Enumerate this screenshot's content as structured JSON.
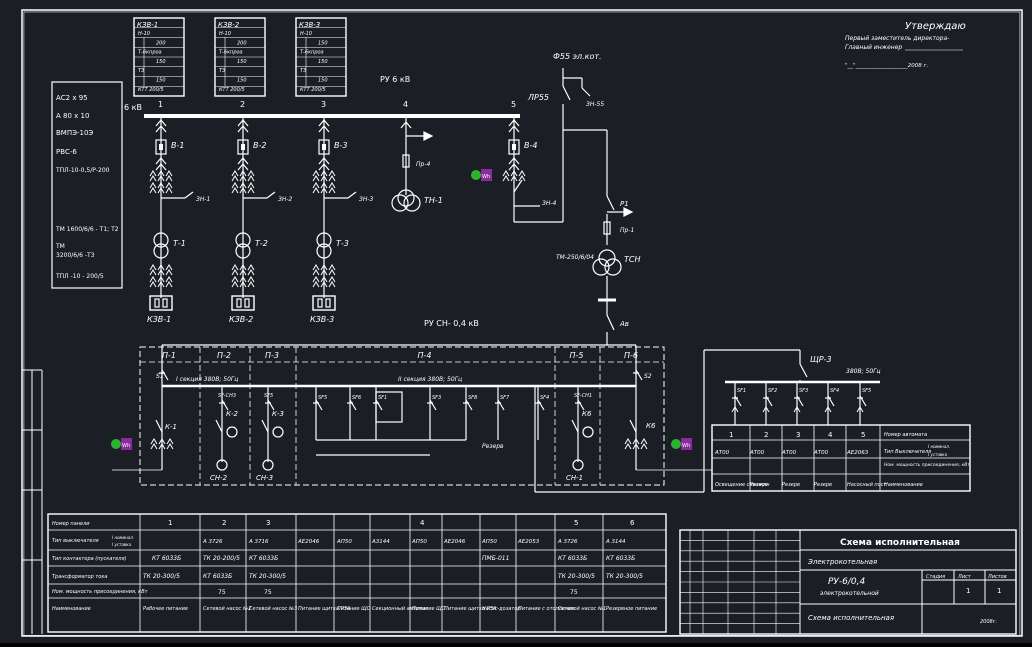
{
  "approval": {
    "title": "Утверждаю",
    "line1": "Первый заместитель директора-",
    "line2": "Главный инженер",
    "date_line": "\"__\"___________________2008 г."
  },
  "cells": [
    {
      "title": "КЗВ-1",
      "rows": [
        "Н-10",
        "200",
        "Т-6кпроа",
        "150",
        "ТЗ",
        "150",
        "КТТ 200/5"
      ]
    },
    {
      "title": "КЗВ-2",
      "rows": [
        "Н-10",
        "200",
        "Т-6кпроа",
        "150",
        "ТЗ",
        "150",
        "КТТ 200/5"
      ]
    },
    {
      "title": "КЗВ-3",
      "rows": [
        "Н-10",
        "150",
        "Т-6кпроа",
        "150",
        "ТЗ",
        "150",
        "КТТ 200/5"
      ]
    }
  ],
  "left_box": {
    "items": [
      "АС2 х 95",
      "А 80 х 10",
      "ВМПЭ-10Э",
      "РВС-6",
      "ТПЛ-10-0,5/Р-200",
      "ТМ 1600/6/6 - Т1; Т2",
      "ТМ",
      "3200/6/6 -Т3",
      "ТПЛ -10 - 200/5"
    ]
  },
  "hv": {
    "ru_label": "РУ 6 кВ",
    "bus_label": "6 кВ",
    "feeders": [
      "1",
      "2",
      "3",
      "4",
      "5"
    ],
    "breakers": [
      "В-1",
      "В-2",
      "В-3",
      "В-4"
    ],
    "earth_switches": [
      "ЗН-1",
      "ЗН-2",
      "ЗН-3",
      "ЗН-4"
    ],
    "transformers": [
      "Т-1",
      "Т-2",
      "Т-3"
    ],
    "outgoing": [
      "КЗВ-1",
      "КЗВ-2",
      "КЗВ-3"
    ],
    "fuse": "Пр-4",
    "vt": "ТН-1",
    "f55": "Ф55 эл.кот.",
    "lr55": "ЛР55",
    "zn55": "ЗН-55",
    "r1": "Р1",
    "pr1": "Пр-1",
    "tsn_type": "ТМ-250/6/04",
    "tsn": "ТСН",
    "av": "Ав",
    "meter": "Wh"
  },
  "lv": {
    "ru_label": "РУ СН- 0,4 кВ",
    "panels": [
      "П-1",
      "П-2",
      "П-3",
      "П-4",
      "П-5",
      "П-6"
    ],
    "sec1": "I секция 380В; 50Гц",
    "sec2": "II секция 380В; 50Гц",
    "switches": [
      "S1",
      "S2"
    ],
    "contactors": [
      "К-1",
      "К-2",
      "К-3",
      "К-4",
      "К6"
    ],
    "breakers": [
      "SF-СН2",
      "SF-СН3",
      "SF5",
      "SF6",
      "SF1",
      "SF3",
      "SF8",
      "SF7",
      "SF4",
      "SF-СН1"
    ],
    "reserve": "Резерв",
    "motors": [
      "СН-2",
      "СН-3",
      "СН-1"
    ]
  },
  "shr": {
    "title": "ЩР-3",
    "voltage": "380В; 50Гц",
    "breakers": [
      "SF1",
      "SF2",
      "SF3",
      "SF4",
      "SF5"
    ],
    "table": {
      "numbers": [
        "1",
        "2",
        "3",
        "4",
        "5"
      ],
      "row_breaker": [
        "АТ00",
        "АТ00",
        "АТ00",
        "АТ00",
        "АЕ2063"
      ],
      "row_power": [
        "",
        "",
        "",
        "",
        ""
      ],
      "row_name": [
        "Освещение скважин",
        "Резерв",
        "Резерв",
        "Резерв",
        "Насосный пост"
      ],
      "label_number": "Номер автомата",
      "label_breaker": "Тип Выключателя",
      "label_nominal": "I номинал.",
      "label_setting": "I уставка",
      "label_power": "Ном. мощность присоединения, кВт",
      "label_name": "Наименование"
    }
  },
  "bottom_table": {
    "col_numbers": [
      "1",
      "2",
      "3",
      "4",
      "5",
      "6"
    ],
    "row_labels": [
      "Номер панели",
      "Тип выключателя",
      "Тип контактора (пускателя)",
      "Трансформатор тока",
      "Ном. мощность присоединения, кВт",
      "Наименование"
    ],
    "label_nominal": "I номинал.",
    "label_setting": "I уставка",
    "breaker_vals": [
      "А 3726",
      "А 3716",
      "АЕ2046",
      "АП50",
      "А3144",
      "АП50",
      "АЕ2046",
      "АП50",
      "АЕ2053",
      "А 3726",
      "А 3144"
    ],
    "contactor_vals": [
      "КТ 6033Б",
      "ТК 20-200/5",
      "КТ 6033Б",
      "ПМБ-011",
      "КТ 6033Б",
      "КТ 6033Б"
    ],
    "ct_vals": [
      "ТК 20-300/5",
      "КТ 6033Б",
      "ТК 20-300/5",
      "ТК 20-300/5",
      "ТК 20-300/5"
    ],
    "power_vals": [
      "75",
      "75",
      "75"
    ],
    "name_vals": [
      "Рабочее питание",
      "Сетевой насос №2",
      "Сетевой насос №3",
      "Питание щитка РЗА",
      "Питание ЩО",
      "Секционный автомат",
      "Питание ЩО",
      "Питание щитка РЗА",
      "Насос-дозатор",
      "Питание с отопления",
      "Сетевой насос №1",
      "Резервное питание"
    ]
  },
  "title_block": {
    "title": "Схема исполнительная",
    "sub1": "Электрокотельная",
    "code": "РУ-6/0,4",
    "sub2": "электрокотельной",
    "sheet_title": "Схема исполнительная",
    "sheet": "1",
    "sheets": "1",
    "col_stage": "Стадия",
    "col_sheet": "Лист",
    "col_sheets": "Листов",
    "year": "2008г."
  },
  "colors": {
    "background": "#1b1e24",
    "line": "#ffffff",
    "frame": "#ffffff",
    "meter_green": "#2db42d",
    "meter_purple": "#8a2b9e"
  }
}
